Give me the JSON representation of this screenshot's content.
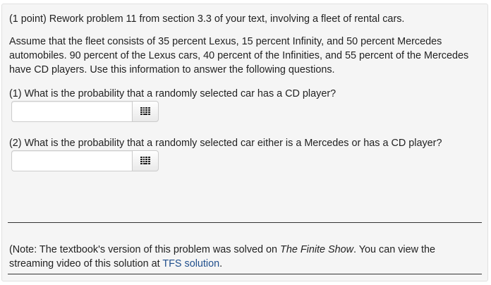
{
  "problem": {
    "intro": "(1 point) Rework problem 11 from section 3.3 of your text, involving a fleet of rental cars.",
    "paragraph": "Assume that the fleet consists of 35 percent Lexus, 15 percent Infinity, and 50 percent Mercedes automobiles. 90 percent of the Lexus cars, 40 percent of the Infinities, and 55 percent of the Mercedes have CD players. Use this information to answer the following questions.",
    "questions": [
      {
        "label": "(1) What is the probability that a randomly selected car has a CD player?",
        "answer_value": ""
      },
      {
        "label": "(2) What is the probability that a randomly selected car either is a Mercedes or has a CD player?",
        "answer_value": ""
      }
    ],
    "note": {
      "prefix": "(Note: The textbook's version of this problem was solved on ",
      "italic": "The Finite Show",
      "middle": ". You can view the streaming video of this solution at ",
      "link": "TFS solution",
      "suffix": "."
    }
  },
  "icons": {
    "answer_button": "keypad-grid-icon"
  },
  "colors": {
    "link": "#1f4e8c",
    "panel_background": "#f5f5f5",
    "text": "#222222"
  }
}
